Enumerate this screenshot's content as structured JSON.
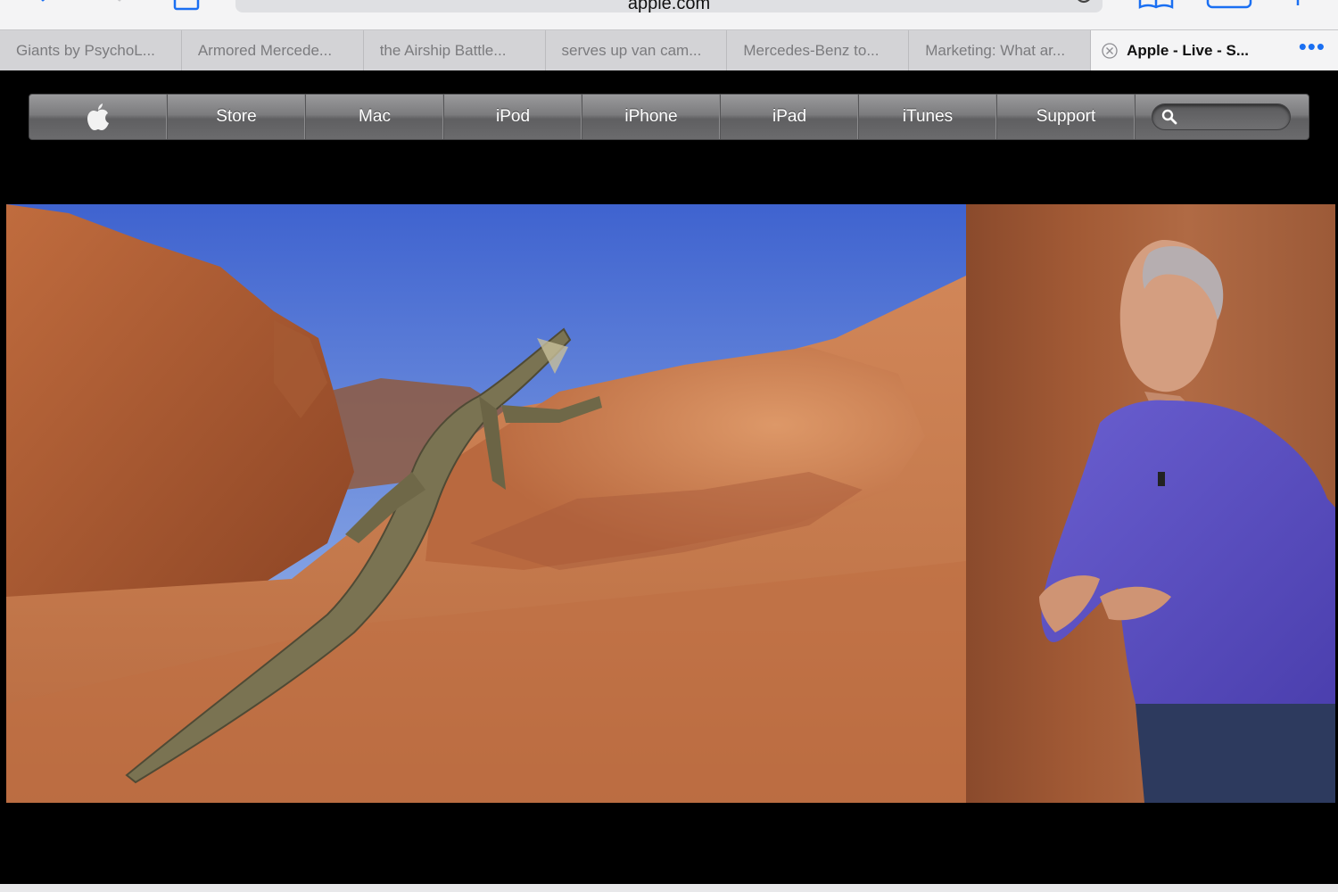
{
  "browser": {
    "address": "apple.com",
    "tabs": [
      {
        "label": "Giants by PsychoL..."
      },
      {
        "label": "Armored Mercede..."
      },
      {
        "label": "the Airship Battle..."
      },
      {
        "label": "serves up van cam..."
      },
      {
        "label": "Mercedes-Benz to..."
      },
      {
        "label": "Marketing: What ar..."
      }
    ],
    "active_tab": {
      "label": "Apple - Live - S..."
    },
    "more_tabs": "•••",
    "accent_color": "#1a6ff2"
  },
  "site_nav": {
    "items": [
      {
        "label": "Store"
      },
      {
        "label": "Mac"
      },
      {
        "label": "iPod"
      },
      {
        "label": "iPhone"
      },
      {
        "label": "iPad"
      },
      {
        "label": "iTunes"
      },
      {
        "label": "Support"
      }
    ],
    "search_placeholder": ""
  },
  "icons": {
    "back": "chevron-left-icon",
    "forward": "chevron-right-icon",
    "share": "share-icon",
    "reload": "reload-icon",
    "bookmarks": "book-icon",
    "tabs": "tabs-icon",
    "new_tab": "plus-icon",
    "logo": "apple-logo-icon",
    "search": "search-icon",
    "close_tab": "close-circle-icon"
  }
}
